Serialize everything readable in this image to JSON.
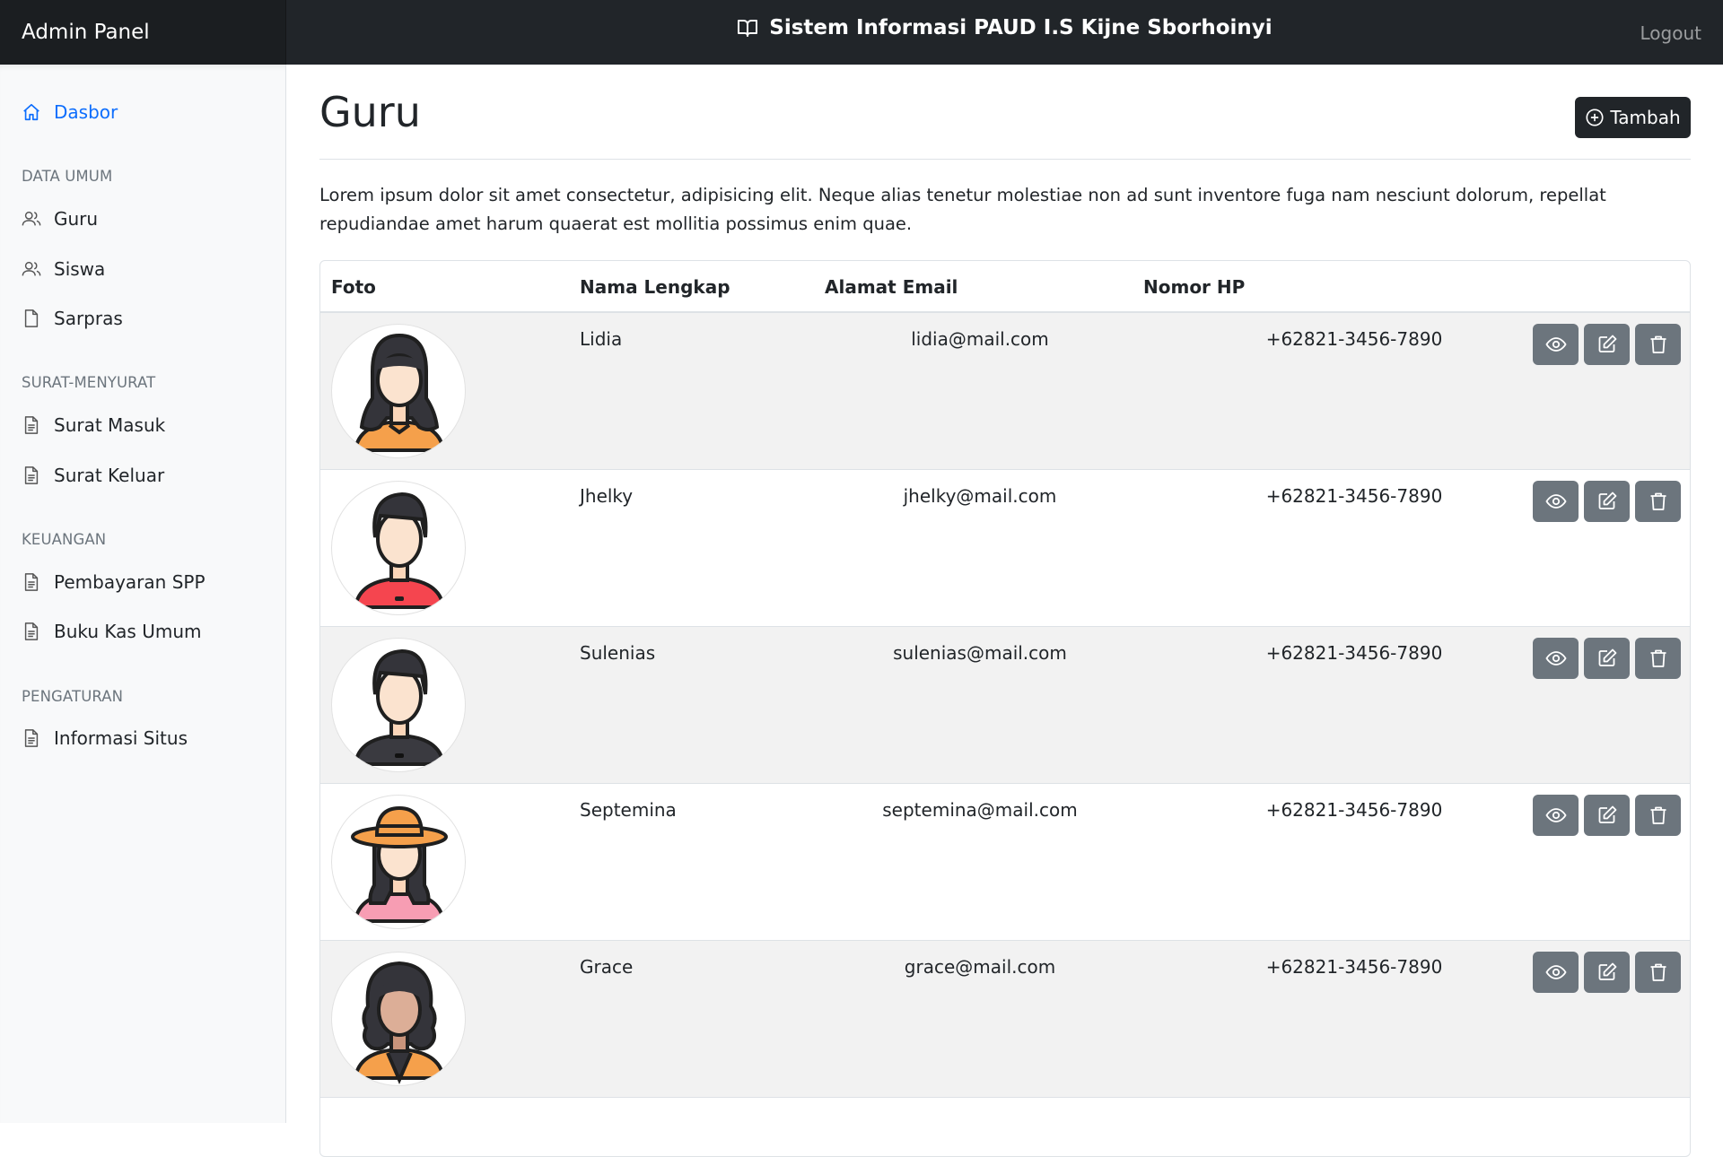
{
  "topbar": {
    "brand": "Admin Panel",
    "site_title": "Sistem Informasi PAUD I.S Kijne Sborhoinyi",
    "logout": "Logout"
  },
  "sidebar": {
    "dashboard": "Dasbor",
    "section_data": "DATA UMUM",
    "guru": "Guru",
    "siswa": "Siswa",
    "sarpras": "Sarpras",
    "section_surat": "SURAT-MENYURAT",
    "surat_masuk": "Surat Masuk",
    "surat_keluar": "Surat Keluar",
    "section_keuangan": "KEUANGAN",
    "spp": "Pembayaran SPP",
    "kas": "Buku Kas Umum",
    "section_pengaturan": "PENGATURAN",
    "info": "Informasi Situs"
  },
  "main": {
    "title": "Guru",
    "add_label": "Tambah",
    "description": "Lorem ipsum dolor sit amet consectetur, adipisicing elit. Neque alias tenetur molestiae non ad sunt inventore fuga nam nesciunt dolorum, repellat repudiandae amet harum quaerat est mollitia possimus enim quae."
  },
  "table": {
    "headers": [
      "Foto",
      "Nama Lengkap",
      "Alamat Email",
      "Nomor HP"
    ],
    "rows": [
      {
        "name": "Lidia",
        "email": "lidia@mail.com",
        "phone": "+62821-3456-7890",
        "avatar": "woman-long-hair-orange-shirt"
      },
      {
        "name": "Jhelky",
        "email": "jhelky@mail.com",
        "phone": "+62821-3456-7890",
        "avatar": "man-red-shirt"
      },
      {
        "name": "Sulenias",
        "email": "sulenias@mail.com",
        "phone": "+62821-3456-7890",
        "avatar": "man-dark-shirt"
      },
      {
        "name": "Septemina",
        "email": "septemina@mail.com",
        "phone": "+62821-3456-7890",
        "avatar": "woman-hat-pink-shirt"
      },
      {
        "name": "Grace",
        "email": "grace@mail.com",
        "phone": "+62821-3456-7890",
        "avatar": "woman-curly-hair"
      }
    ],
    "row_actions": [
      "eye-icon",
      "edit-icon",
      "trash-icon"
    ]
  },
  "colors": {
    "topbar": "#212529",
    "sidebar": "#f8f9fa",
    "active_link": "#0d6efd",
    "action_button": "#6c757d",
    "striped_row": "#f2f2f2"
  }
}
